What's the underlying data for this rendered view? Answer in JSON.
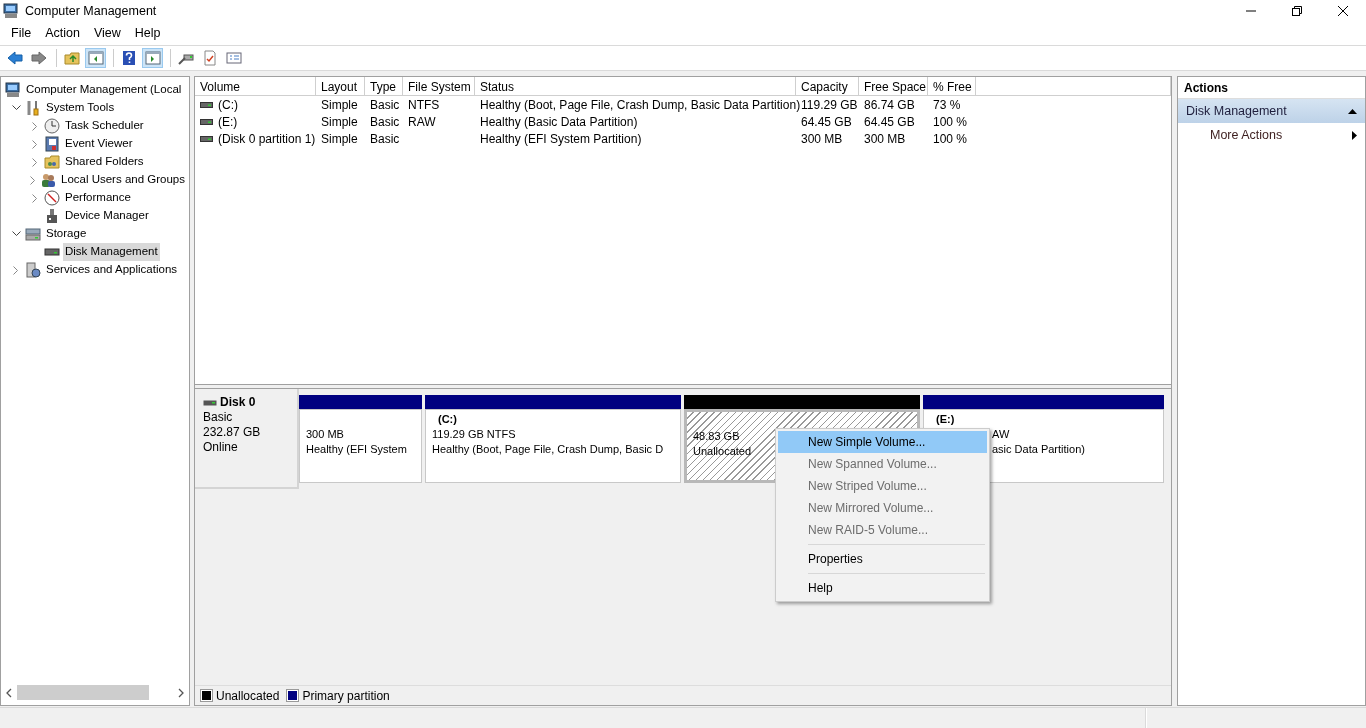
{
  "window": {
    "title": "Computer Management"
  },
  "menu": [
    "File",
    "Action",
    "View",
    "Help"
  ],
  "tree": [
    {
      "label": "Computer Management (Local",
      "selected": false,
      "children": [
        {
          "label": "System Tools",
          "expanded": true,
          "selected": false,
          "children": [
            {
              "label": "Task Scheduler",
              "expanded": false,
              "selected": false
            },
            {
              "label": "Event Viewer",
              "expanded": false,
              "selected": false
            },
            {
              "label": "Shared Folders",
              "expanded": false,
              "selected": false
            },
            {
              "label": "Local Users and Groups",
              "expanded": false,
              "selected": false
            },
            {
              "label": "Performance",
              "expanded": false,
              "selected": false
            },
            {
              "label": "Device Manager",
              "selected": false
            }
          ]
        },
        {
          "label": "Storage",
          "expanded": true,
          "selected": false,
          "children": [
            {
              "label": "Disk Management",
              "selected": true
            }
          ]
        },
        {
          "label": "Services and Applications",
          "expanded": false,
          "selected": false
        }
      ]
    }
  ],
  "table": {
    "columns": [
      "Volume",
      "Layout",
      "Type",
      "File System",
      "Status",
      "Capacity",
      "Free Space",
      "% Free"
    ],
    "rows": [
      [
        "(C:)",
        "Simple",
        "Basic",
        "NTFS",
        "Healthy (Boot, Page File, Crash Dump, Basic Data Partition)",
        "119.29 GB",
        "86.74 GB",
        "73 %"
      ],
      [
        "(E:)",
        "Simple",
        "Basic",
        "RAW",
        "Healthy (Basic Data Partition)",
        "64.45 GB",
        "64.45 GB",
        "100 %"
      ],
      [
        "(Disk 0 partition 1)",
        "Simple",
        "Basic",
        null,
        "Healthy (EFI System Partition)",
        "300 MB",
        "300 MB",
        "100 %"
      ]
    ]
  },
  "disk": {
    "name": "Disk 0",
    "type": "Basic",
    "size": "232.87 GB",
    "status": "Online"
  },
  "partitions": [
    {
      "kind": "primary",
      "size": "300 MB",
      "status": "Healthy (EFI System",
      "selected": false
    },
    {
      "kind": "primary",
      "title": "(C:)",
      "size": "119.29 GB NTFS",
      "status": "Healthy (Boot, Page File, Crash Dump, Basic D",
      "selected": false
    },
    {
      "kind": "unallocated",
      "size": "48.83 GB",
      "status": "Unallocated",
      "selected": true
    },
    {
      "kind": "primary",
      "title": "(E:)",
      "size": "AW",
      "status": "asic Data Partition)",
      "selected": false
    }
  ],
  "context_menu": [
    {
      "kind": "item",
      "label": "New Simple Volume...",
      "disabled": false,
      "selected": true
    },
    {
      "kind": "item",
      "label": "New Spanned Volume...",
      "disabled": true,
      "selected": false
    },
    {
      "kind": "item",
      "label": "New Striped Volume...",
      "disabled": true,
      "selected": false
    },
    {
      "kind": "item",
      "label": "New Mirrored Volume...",
      "disabled": true,
      "selected": false
    },
    {
      "kind": "item",
      "label": "New RAID-5 Volume...",
      "disabled": true,
      "selected": false
    },
    {
      "kind": "separator"
    },
    {
      "kind": "item",
      "label": "Properties",
      "disabled": false,
      "selected": false
    },
    {
      "kind": "separator"
    },
    {
      "kind": "item",
      "label": "Help",
      "disabled": false,
      "selected": false
    }
  ],
  "actions": {
    "title": "Actions",
    "section": {
      "label": "Disk Management",
      "expanded": true,
      "items": [
        {
          "label": "More Actions"
        }
      ]
    }
  },
  "legend": [
    {
      "label": "Unallocated",
      "color": "#000000"
    },
    {
      "label": "Primary partition",
      "color": "#000080"
    }
  ]
}
